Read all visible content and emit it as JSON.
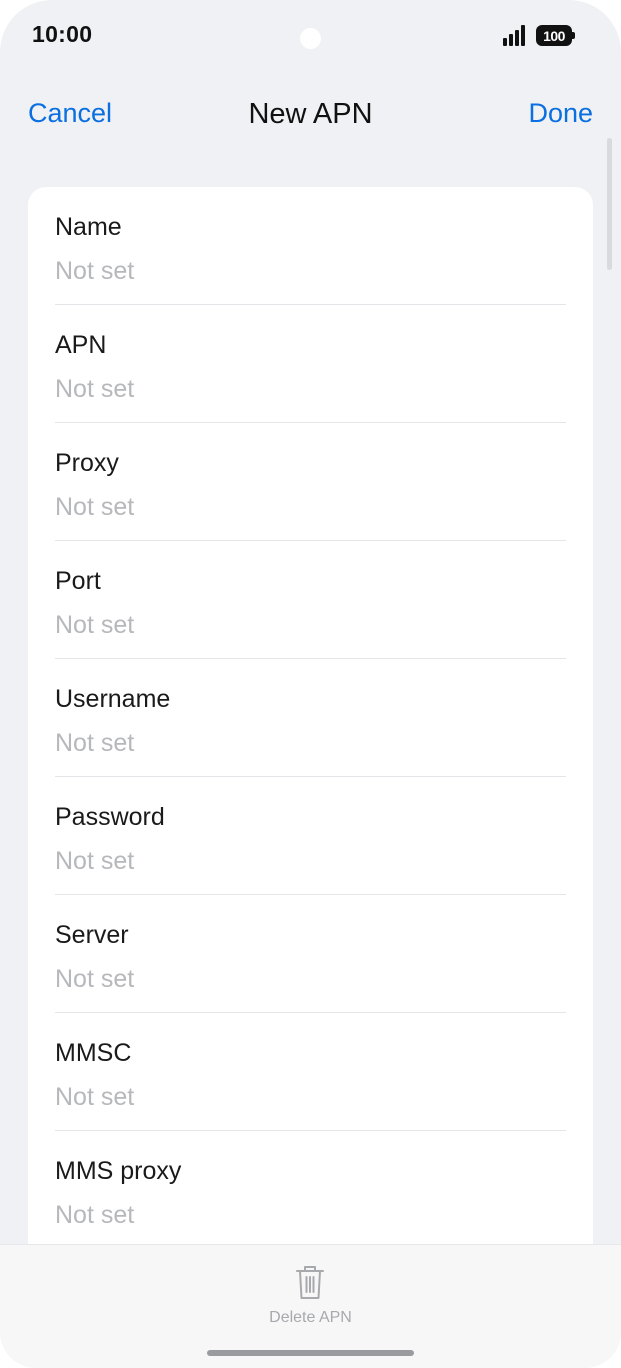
{
  "status_bar": {
    "time": "10:00",
    "battery": "100",
    "icons": [
      "signal-icon",
      "battery-icon"
    ]
  },
  "nav": {
    "cancel_label": "Cancel",
    "title": "New APN",
    "done_label": "Done"
  },
  "fields": [
    {
      "label": "Name",
      "value": "Not set"
    },
    {
      "label": "APN",
      "value": "Not set"
    },
    {
      "label": "Proxy",
      "value": "Not set"
    },
    {
      "label": "Port",
      "value": "Not set"
    },
    {
      "label": "Username",
      "value": "Not set"
    },
    {
      "label": "Password",
      "value": "Not set"
    },
    {
      "label": "Server",
      "value": "Not set"
    },
    {
      "label": "MMSC",
      "value": "Not set"
    },
    {
      "label": "MMS proxy",
      "value": "Not set"
    }
  ],
  "bottom_bar": {
    "delete_label": "Delete APN",
    "delete_icon": "trash-icon"
  },
  "colors": {
    "accent": "#0a6fe0",
    "background": "#f0f1f4",
    "card": "#ffffff",
    "placeholder": "#b7b8bb"
  }
}
